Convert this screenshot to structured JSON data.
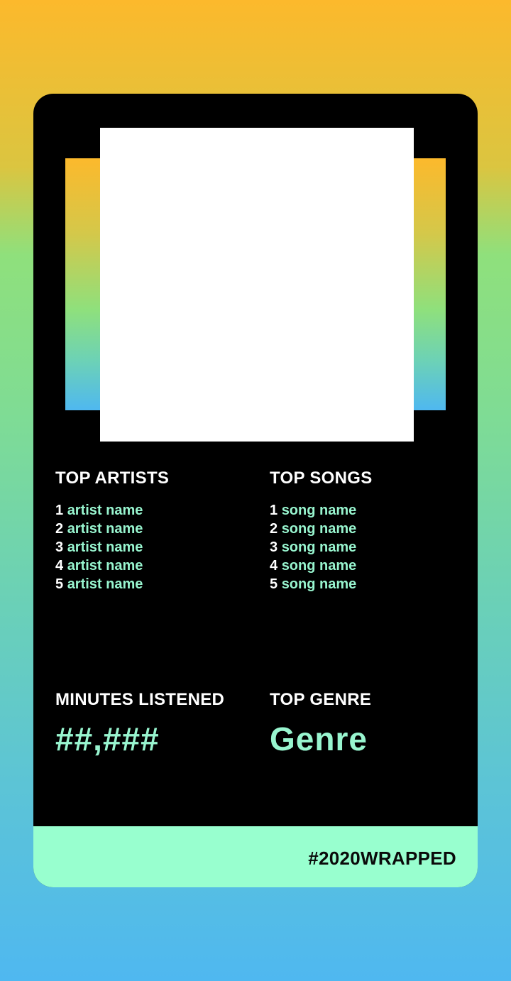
{
  "colors": {
    "accent": "#98f5cf",
    "footer_bg": "#98ffcf",
    "card_bg": "#000000",
    "gradient_top": "#fcb92c",
    "gradient_mid": "#8fe07c",
    "gradient_bottom": "#4fb8f0"
  },
  "cover": {
    "image": "album-cover-placeholder"
  },
  "top_artists": {
    "title": "TOP ARTISTS",
    "items": [
      {
        "rank": "1",
        "name": "artist name"
      },
      {
        "rank": "2",
        "name": "artist name"
      },
      {
        "rank": "3",
        "name": "artist name"
      },
      {
        "rank": "4",
        "name": "artist name"
      },
      {
        "rank": "5",
        "name": "artist name"
      }
    ]
  },
  "top_songs": {
    "title": "TOP SONGS",
    "items": [
      {
        "rank": "1",
        "name": "song name"
      },
      {
        "rank": "2",
        "name": "song name"
      },
      {
        "rank": "3",
        "name": "song name"
      },
      {
        "rank": "4",
        "name": "song name"
      },
      {
        "rank": "5",
        "name": "song name"
      }
    ]
  },
  "minutes": {
    "title": "MINUTES LISTENED",
    "value": "##,###"
  },
  "genre": {
    "title": "TOP GENRE",
    "value": "Genre"
  },
  "footer": {
    "hashtag": "#2020WRAPPED"
  }
}
